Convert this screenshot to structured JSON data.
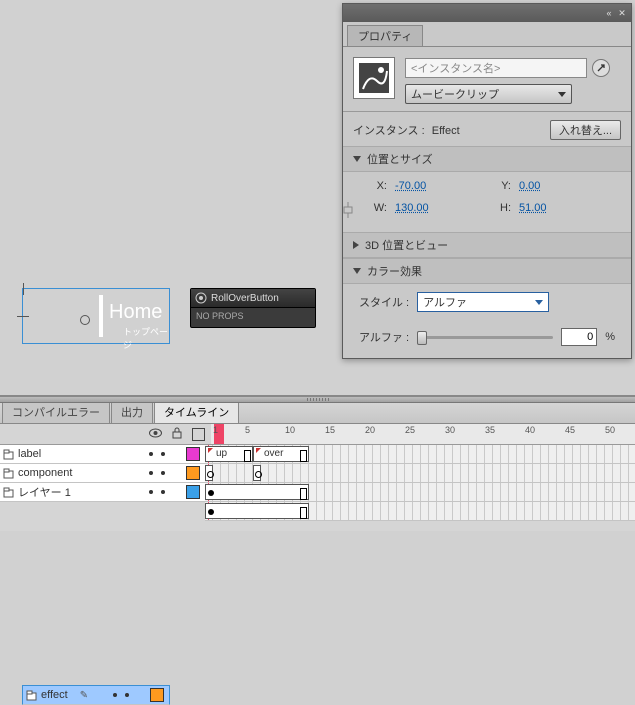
{
  "panel": {
    "tab": "プロパティ",
    "instancePlaceholder": "<インスタンス名>",
    "typeDropdown": "ムービークリップ",
    "instanceLabel": "インスタンス :",
    "instanceValue": "Effect",
    "swapButton": "入れ替え...",
    "sections": {
      "posSize": "位置とサイズ",
      "pos3d": "3D 位置とビュー",
      "colorFx": "カラー効果"
    },
    "coords": {
      "xLabel": "X:",
      "x": "-70.00",
      "yLabel": "Y:",
      "y": "0.00",
      "wLabel": "W:",
      "w": "130.00",
      "hLabel": "H:",
      "h": "51.00"
    },
    "styleLabel": "スタイル :",
    "styleValue": "アルファ",
    "alphaLabel": "アルファ :",
    "alphaValue": "0",
    "alphaUnit": "%"
  },
  "stage": {
    "homeText": "Home",
    "homeSub": "トップページ",
    "compName": "RollOverButton",
    "compNoProps": "NO PROPS"
  },
  "timeline": {
    "tabs": {
      "compile": "コンパイルエラー",
      "output": "出力",
      "timeline": "タイムライン"
    },
    "rulerNums": [
      "1",
      "5",
      "10",
      "15",
      "20",
      "25",
      "30",
      "35",
      "40",
      "45",
      "50"
    ],
    "layers": [
      {
        "name": "label",
        "color": "#e83ad0",
        "selected": false,
        "pencil": false
      },
      {
        "name": "effect",
        "color": "#ff9a1f",
        "selected": true,
        "pencil": true
      },
      {
        "name": "component",
        "color": "#ff9a1f",
        "selected": false,
        "pencil": false
      },
      {
        "name": "レイヤー 1",
        "color": "#3aa0e8",
        "selected": false,
        "pencil": false
      }
    ],
    "labelSegs": {
      "up": "up",
      "over": "over"
    }
  }
}
